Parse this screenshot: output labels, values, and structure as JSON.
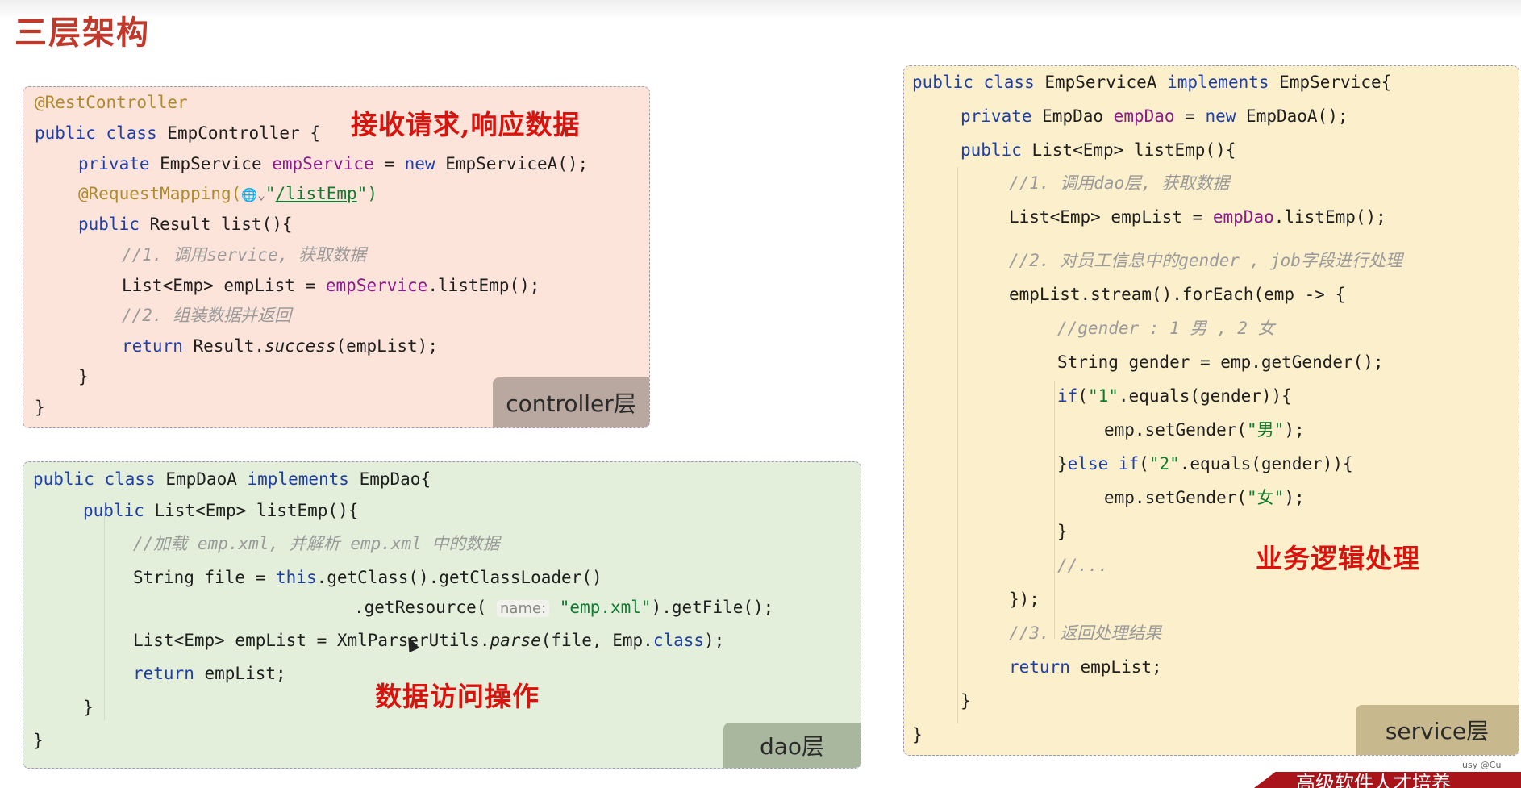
{
  "slide": {
    "title": "三层架构",
    "watermark": "lusy @Cu",
    "banner": "高级软件人才培养"
  },
  "controller_panel": {
    "label": "controller层",
    "annotation": "接收请求,响应数据",
    "lines": {
      "l1": "@RestController",
      "l2_kw": "public class",
      "l2_rest": " EmpController {",
      "l3_kw": "private",
      "l3_type": " EmpService ",
      "l3_field": "empService",
      "l3_eq": " = ",
      "l3_new": "new",
      "l3_rest": " EmpServiceA();",
      "l4_ann": "@RequestMapping(",
      "l4_icon": "🌐⌄",
      "l4_q1": "\"",
      "l4_url": "/listEmp",
      "l4_q2": "\")",
      "l5_kw": "public",
      "l5_rest": " Result list(){",
      "l6": "//1. 调用service, 获取数据",
      "l7_a": "List<Emp> empList = ",
      "l7_field": "empService",
      "l7_b": ".listEmp();",
      "l8": "//2. 组装数据并返回",
      "l9_kw": "return",
      "l9_a": " Result.",
      "l9_it": "success",
      "l9_b": "(empList);",
      "l10": "}",
      "l11": "}"
    }
  },
  "dao_panel": {
    "label": "dao层",
    "annotation": "数据访问操作",
    "lines": {
      "l1_kw": "public class",
      "l1_a": " EmpDaoA ",
      "l1_kw2": "implements",
      "l1_b": " EmpDao{",
      "l2_kw": "public",
      "l2_rest": " List<Emp> listEmp(){",
      "l3": "//加载 emp.xml, 并解析 emp.xml 中的数据",
      "l4_a": "String file = ",
      "l4_kw": "this",
      "l4_b": ".getClass().getClassLoader()",
      "l5_a": ".getResource( ",
      "l5_hint": "name:",
      "l5_str": " \"emp.xml\"",
      "l5_b": ").getFile();",
      "l6_a": "List<Emp> empList = XmlParserUtils.",
      "l6_it": "parse",
      "l6_b": "(file, Emp.",
      "l6_kw": "class",
      "l6_c": ");",
      "l7_kw": "return",
      "l7_rest": " empList;",
      "l8": "}",
      "l9": "}"
    }
  },
  "service_panel": {
    "label": "service层",
    "annotation": "业务逻辑处理",
    "lines": {
      "l1_kw": "public class",
      "l1_a": " EmpServiceA ",
      "l1_kw2": "implements",
      "l1_b": " EmpService{",
      "l2_kw": "private",
      "l2_a": " EmpDao ",
      "l2_field": "empDao",
      "l2_b": " = ",
      "l2_new": "new",
      "l2_c": " EmpDaoA();",
      "l3_kw": "public",
      "l3_rest": " List<Emp> listEmp(){",
      "l4": "//1. 调用dao层, 获取数据",
      "l5_a": "List<Emp> empList = ",
      "l5_field": "empDao",
      "l5_b": ".listEmp();",
      "l6": "//2. 对员工信息中的gender , job字段进行处理",
      "l7": "empList.stream().forEach(emp -> {",
      "l8": "//gender : 1 男 , 2 女",
      "l9": "String gender = emp.getGender();",
      "l10_kw": "if",
      "l10_a": "(",
      "l10_str": "\"1\"",
      "l10_b": ".equals(gender)){",
      "l11_a": "emp.setGender(",
      "l11_str": "\"男\"",
      "l11_b": ");",
      "l12_a": "}",
      "l12_kw": "else if",
      "l12_b": "(",
      "l12_str": "\"2\"",
      "l12_c": ".equals(gender)){",
      "l13_a": "emp.setGender(",
      "l13_str": "\"女\"",
      "l13_b": ");",
      "l14": "}",
      "l15": "//...",
      "l16": "});",
      "l17": "//3. 返回处理结果",
      "l18_kw": "return",
      "l18_rest": " empList;",
      "l19": "}",
      "l20": "}"
    }
  }
}
